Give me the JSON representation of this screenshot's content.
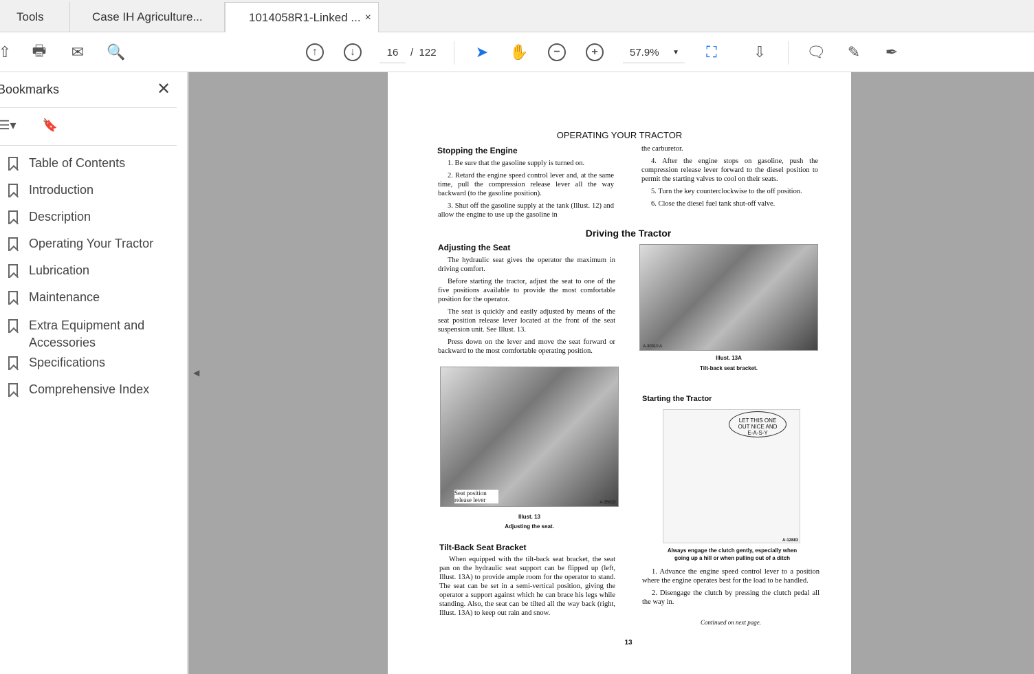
{
  "tabs": [
    {
      "label": "Tools"
    },
    {
      "label": "Case IH Agriculture..."
    },
    {
      "label": "1014058R1-Linked ...",
      "close": "×"
    }
  ],
  "toolbar": {
    "page_current": "16",
    "page_sep": "/",
    "page_total": "122",
    "zoom": "57.9%"
  },
  "sidebar": {
    "title": "Bookmarks",
    "close": "✕",
    "items": [
      {
        "label": "Table of Contents"
      },
      {
        "label": "Introduction"
      },
      {
        "label": "Description"
      },
      {
        "label": "Operating Your Tractor"
      },
      {
        "label": "Lubrication"
      },
      {
        "label": "Maintenance"
      },
      {
        "label": "Extra Equipment and Accessories"
      },
      {
        "label": "Specifications"
      },
      {
        "label": "Comprehensive Index"
      }
    ]
  },
  "doc": {
    "title": "OPERATING YOUR TRACTOR",
    "stopping_heading": "Stopping the Engine",
    "stop1": "1. Be sure that the gasoline supply is turned on.",
    "stop2": "2. Retard the engine speed control lever and, at the same time, pull the compression release lever all the way backward (to the gasoline position).",
    "stop3": "3. Shut off the gasoline supply at the tank (Illust. 12) and allow the engine to use up the gasoline in",
    "stop3b": "the carburetor.",
    "stop4": "4. After the engine stops on gasoline, push the compression release lever forward to the diesel position to permit the starting valves to cool on their seats.",
    "stop5": "5. Turn the key counterclockwise to the off position.",
    "stop6": "6. Close the diesel fuel tank shut-off valve.",
    "driving_heading": "Driving the Tractor",
    "seat_heading": "Adjusting the Seat",
    "seat1": "The hydraulic seat gives the operator the maximum in driving comfort.",
    "seat2": "Before starting the tractor, adjust the seat to one of the five positions available to provide the most comfortable position for the operator.",
    "seat3": "The seat is quickly and easily adjusted by means of the seat position release lever located at the front of the seat suspension unit. See Illust. 13.",
    "seat4": "Press down on the lever and move the seat forward or backward to the most comfortable operating position.",
    "illus13a_code": "A-30310 A",
    "illus13a": "Illust. 13A",
    "illus13a_cap": "Tilt-back seat bracket.",
    "illus13_label": "Seat position release lever",
    "illus13_code": "A-35813",
    "illus13": "Illust. 13",
    "illus13_cap": "Adjusting the seat.",
    "starting_heading": "Starting the Tractor",
    "cartoon_text": "LET THIS ONE OUT NICE AND E-A-S-Y",
    "cartoon_code": "A-12883",
    "cartoon_cap": "Always engage the clutch gently, especially when going up a hill or when pulling out of a ditch",
    "tilt_heading": "Tilt-Back Seat Bracket",
    "tilt1": "When equipped with the tilt-back seat bracket, the seat pan on the hydraulic seat support can be flipped up (left, Illust. 13A) to provide ample room for the operator to stand. The seat can be set in a semi-vertical position, giving the operator a support against which he can brace his legs while standing. Also, the seat can be tilted all the way back (right, Illust. 13A) to keep out rain and snow.",
    "start1": "1. Advance the engine speed control lever to a position where the engine operates best for the load to be handled.",
    "start2": "2. Disengage the clutch by pressing the clutch pedal all the way in.",
    "continued": "Continued on next page.",
    "page_number": "13"
  }
}
